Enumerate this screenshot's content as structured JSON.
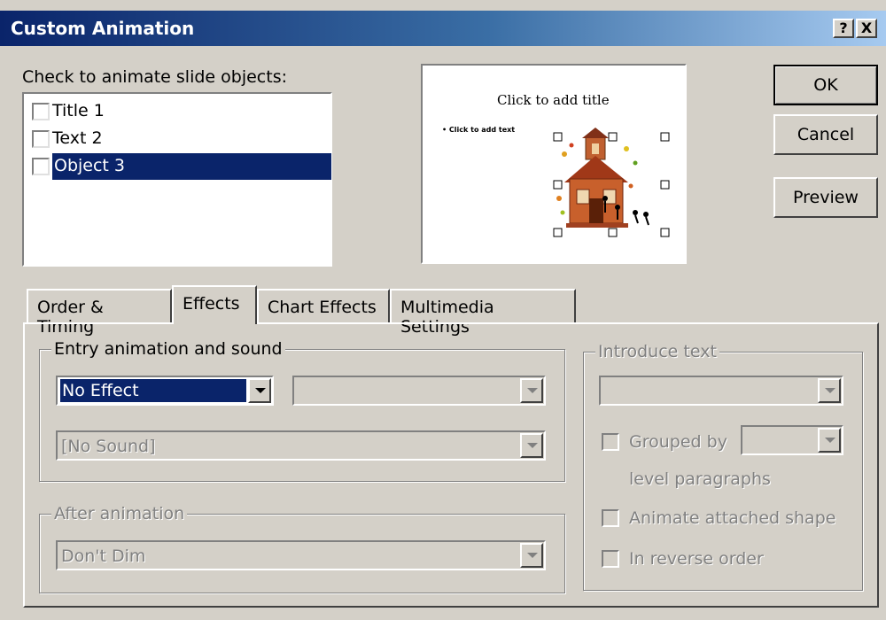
{
  "window": {
    "title": "Custom Animation",
    "help_btn": "?",
    "close_btn": "X"
  },
  "objects": {
    "label": "Check to animate slide objects:",
    "items": [
      {
        "label": "Title 1",
        "checked": false,
        "selected": false
      },
      {
        "label": "Text 2",
        "checked": false,
        "selected": false
      },
      {
        "label": "Object 3",
        "checked": false,
        "selected": true
      }
    ]
  },
  "preview": {
    "title": "Click to add title",
    "bullet_text": "Click to add text",
    "image": "schoolhouse-clipart"
  },
  "buttons": {
    "ok": "OK",
    "cancel": "Cancel",
    "preview": "Preview"
  },
  "tabs": [
    {
      "label": "Order & Timing",
      "active": false
    },
    {
      "label": "Effects",
      "active": true
    },
    {
      "label": "Chart Effects",
      "active": false
    },
    {
      "label": "Multimedia Settings",
      "active": false
    }
  ],
  "entry": {
    "group_label": "Entry animation and sound",
    "effect_value": "No Effect",
    "direction_value": "",
    "sound_value": "[No Sound]"
  },
  "after": {
    "group_label": "After animation",
    "value": "Don't Dim"
  },
  "introduce": {
    "group_label": "Introduce text",
    "value": "",
    "grouped_by_label": "Grouped by",
    "grouped_value": "",
    "level_label": "level paragraphs",
    "attached_label": "Animate attached shape",
    "reverse_label": "In reverse order"
  },
  "colors": {
    "titlebar": "#0a246a",
    "selection": "#0a246a",
    "face": "#d4d0c8"
  }
}
